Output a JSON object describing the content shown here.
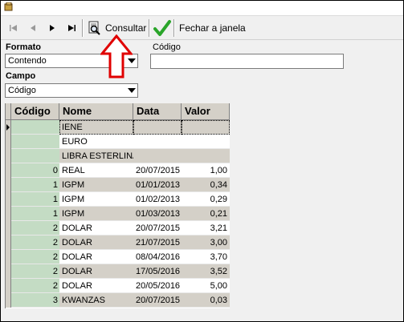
{
  "toolbar": {
    "first_icon": "first-record-icon",
    "prev_icon": "previous-record-icon",
    "next_icon": "next-record-icon",
    "last_icon": "last-record-icon",
    "consultar_label": "Consultar",
    "fechar_label": "Fechar a janela"
  },
  "filters": {
    "formato_label": "Formato",
    "formato_value": "Contendo",
    "campo_label": "Campo",
    "campo_value": "Código",
    "codigo_label": "Código",
    "codigo_value": ""
  },
  "grid": {
    "columns": [
      "Código",
      "Nome",
      "Data",
      "Valor"
    ],
    "rows": [
      {
        "codigo": "",
        "nome": "IENE",
        "data": "",
        "valor": ""
      },
      {
        "codigo": "",
        "nome": "EURO",
        "data": "",
        "valor": ""
      },
      {
        "codigo": "",
        "nome": "LIBRA ESTERLINA",
        "data": "",
        "valor": ""
      },
      {
        "codigo": "0",
        "nome": "REAL",
        "data": "20/07/2015",
        "valor": "1,00"
      },
      {
        "codigo": "1",
        "nome": "IGPM",
        "data": "01/01/2013",
        "valor": "0,34"
      },
      {
        "codigo": "1",
        "nome": "IGPM",
        "data": "01/02/2013",
        "valor": "0,29"
      },
      {
        "codigo": "1",
        "nome": "IGPM",
        "data": "01/03/2013",
        "valor": "0,21"
      },
      {
        "codigo": "2",
        "nome": "DOLAR",
        "data": "20/07/2015",
        "valor": "3,21"
      },
      {
        "codigo": "2",
        "nome": "DOLAR",
        "data": "21/07/2015",
        "valor": "3,00"
      },
      {
        "codigo": "2",
        "nome": "DOLAR",
        "data": "08/04/2016",
        "valor": "3,70"
      },
      {
        "codigo": "2",
        "nome": "DOLAR",
        "data": "17/05/2016",
        "valor": "3,52"
      },
      {
        "codigo": "2",
        "nome": "DOLAR",
        "data": "20/05/2016",
        "valor": "5,00"
      },
      {
        "codigo": "3",
        "nome": "KWANZAS",
        "data": "20/07/2015",
        "valor": "0,03"
      }
    ]
  },
  "colors": {
    "codigo_column_bg": "#c4dcc4",
    "alt_row_bg": "#d4d0c8",
    "annotation_arrow": "#e00000"
  }
}
